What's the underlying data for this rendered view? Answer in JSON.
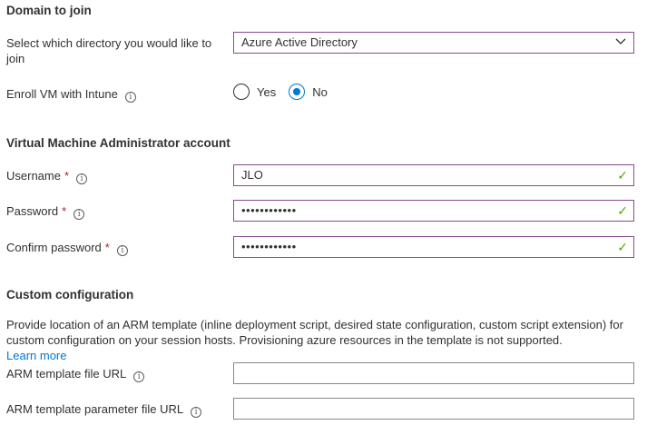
{
  "domain_section": {
    "title": "Domain to join",
    "directory_label": "Select which directory you would like to join",
    "directory_value": "Azure Active Directory",
    "intune_label": "Enroll VM with Intune",
    "intune_options": [
      "Yes",
      "No"
    ],
    "intune_selected": "No"
  },
  "admin_section": {
    "title": "Virtual Machine Administrator account",
    "username_label": "Username",
    "username_value": "JLO",
    "password_label": "Password",
    "password_value": "••••••••••••",
    "confirm_label": "Confirm password",
    "confirm_value": "••••••••••••",
    "required_marker": "*"
  },
  "custom_section": {
    "title": "Custom configuration",
    "description": "Provide location of an ARM template (inline deployment script, desired state configuration, custom script extension) for custom configuration on your session hosts. Provisioning azure resources in the template is not supported.",
    "learn_more": "Learn more",
    "template_label": "ARM template file URL",
    "template_value": "",
    "param_label": "ARM template parameter file URL",
    "param_value": ""
  },
  "icons": {
    "info": "ⓘ",
    "check": "✓"
  },
  "colors": {
    "accent": "#0078d4",
    "valid_check": "#57a300",
    "required": "#a4262c",
    "focus_border": "#8a4a8f"
  }
}
